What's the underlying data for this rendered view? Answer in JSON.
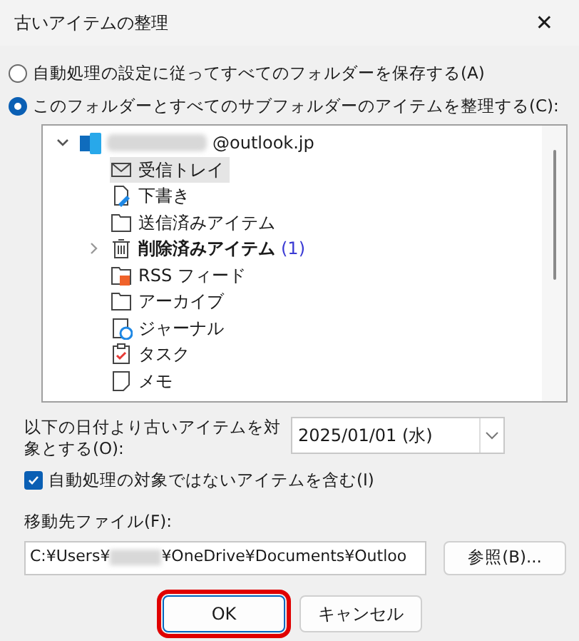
{
  "window": {
    "title": "古いアイテムの整理",
    "close": "✕"
  },
  "options": [
    {
      "label": "自動処理の設定に従ってすべてのフォルダーを保存する(A)",
      "selected": false
    },
    {
      "label": "このフォルダーとすべてのサブフォルダーのアイテムを整理する(C):",
      "selected": true
    }
  ],
  "tree": [
    {
      "label": "@outlook.jp",
      "kind": "account",
      "redacted": true,
      "expanded": true,
      "selected": false,
      "children": [
        {
          "label": "受信トレイ",
          "kind": "inbox",
          "selected": true
        },
        {
          "label": "下書き",
          "kind": "drafts",
          "selected": false
        },
        {
          "label": "送信済みアイテム",
          "kind": "folder",
          "selected": false
        },
        {
          "label": "削除済みアイテム",
          "kind": "trash",
          "count": "(1)",
          "expanded": false,
          "selected": false
        },
        {
          "label": "RSS フィード",
          "kind": "rss",
          "selected": false
        },
        {
          "label": "アーカイブ",
          "kind": "folder",
          "selected": false
        },
        {
          "label": "ジャーナル",
          "kind": "journal",
          "selected": false
        },
        {
          "label": "タスク",
          "kind": "tasks",
          "selected": false
        },
        {
          "label": "メモ",
          "kind": "notes",
          "selected": false
        }
      ]
    }
  ],
  "date": {
    "label": "以下の日付より古いアイテムを対象とする(O):",
    "value": "2025/01/01 (水)"
  },
  "include_unarchived": {
    "label": "自動処理の対象ではないアイテムを含む(I)",
    "checked": true
  },
  "target_file": {
    "label": "移動先ファイル(F):",
    "value_start": "C:¥Users¥",
    "value_end": "¥OneDrive¥Documents¥Outloo",
    "browse": "参照(B)..."
  },
  "buttons": [
    {
      "label": "OK",
      "highlighted": true
    },
    {
      "label": "キャンセル",
      "highlighted": false
    }
  ]
}
